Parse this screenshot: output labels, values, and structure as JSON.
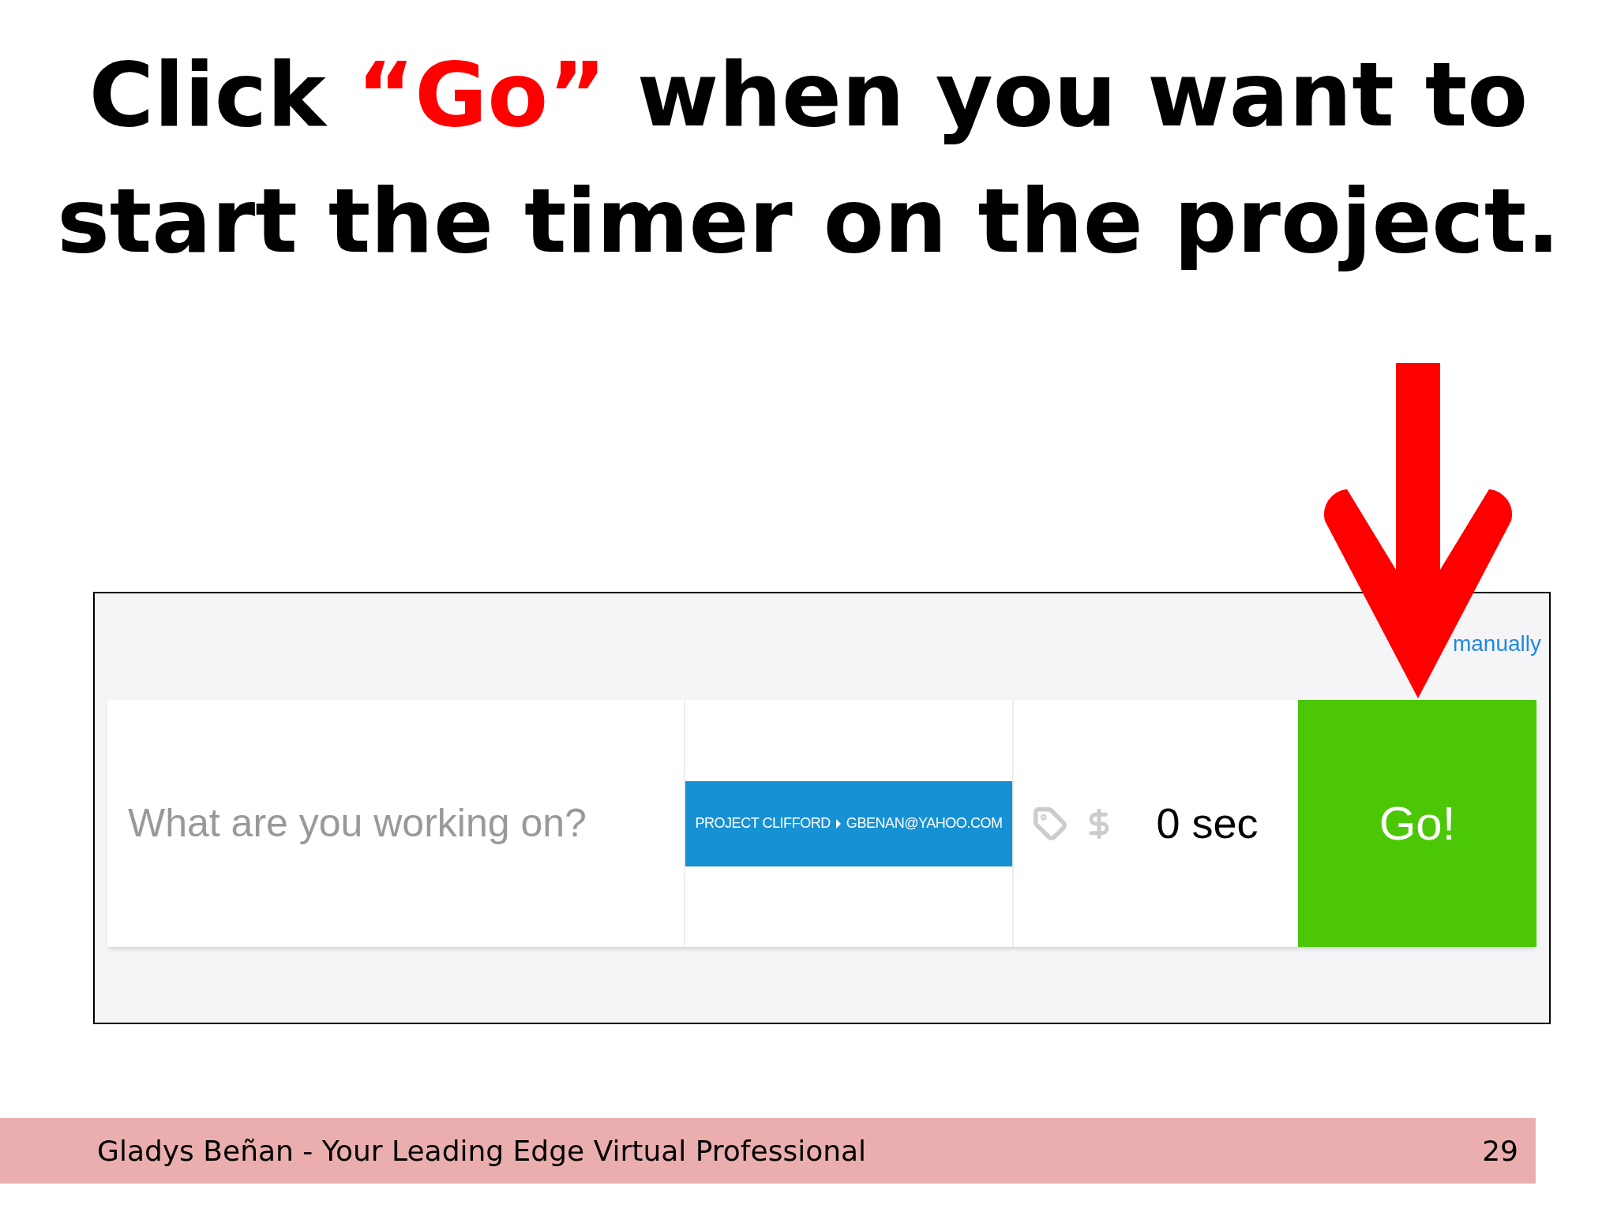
{
  "title": [
    {
      "text": "Click ",
      "kind": "plain"
    },
    {
      "text": "“Go”",
      "kind": "highlight"
    },
    {
      "text": " when you want to start the timer on the project.",
      "kind": "plain"
    }
  ],
  "timer_bar": {
    "add_link": "manually",
    "description": {
      "placeholder": "What are you working on?"
    },
    "project": {
      "name": "PROJECT CLIFFORD",
      "client": "GBENAN@YAHOO.COM"
    },
    "billable": false,
    "duration": "0 sec",
    "start_button": "Go!"
  },
  "footer": {
    "text": "Gladys Beñan - Your Leading Edge Virtual Professional",
    "page": "29"
  }
}
